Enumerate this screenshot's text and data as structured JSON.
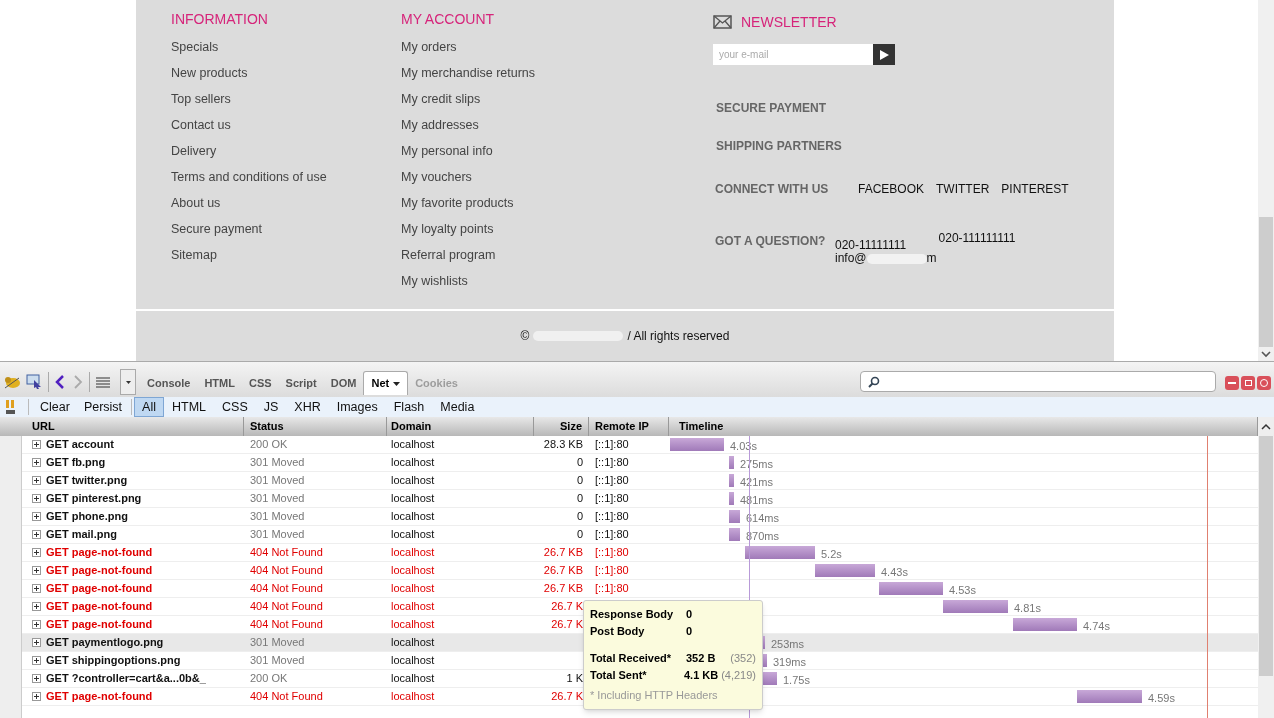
{
  "footer": {
    "columns": [
      {
        "title": "INFORMATION",
        "items": [
          "Specials",
          "New products",
          "Top sellers",
          "Contact us",
          "Delivery",
          "Terms and conditions of use",
          "About us",
          "Secure payment",
          "Sitemap"
        ]
      },
      {
        "title": "MY ACCOUNT",
        "items": [
          "My orders",
          "My merchandise returns",
          "My credit slips",
          "My addresses",
          "My personal info",
          "My vouchers",
          "My favorite products",
          "My loyalty points",
          "Referral program",
          "My wishlists"
        ]
      }
    ],
    "newsletter": {
      "title": "NEWSLETTER",
      "placeholder": "your e-mail"
    },
    "secure_payment": "SECURE PAYMENT",
    "shipping_partners": "SHIPPING PARTNERS",
    "connect": {
      "label": "CONNECT WITH US",
      "links": [
        "FACEBOOK",
        "TWITTER",
        "PINTEREST"
      ]
    },
    "question": {
      "label": "GOT A QUESTION?",
      "phone_1": "020-11111111",
      "phone_2": "020-111111111",
      "email_prefix": "info@",
      "email_suffix": "m"
    },
    "copyright": {
      "symbol": "©",
      "text": "/ All rights reserved"
    }
  },
  "firebug": {
    "tabs": [
      {
        "label": "Console",
        "selected": false,
        "disabled": false
      },
      {
        "label": "HTML",
        "selected": false,
        "disabled": false
      },
      {
        "label": "CSS",
        "selected": false,
        "disabled": false
      },
      {
        "label": "Script",
        "selected": false,
        "disabled": false
      },
      {
        "label": "DOM",
        "selected": false,
        "disabled": false
      },
      {
        "label": "Net",
        "selected": true,
        "disabled": false
      },
      {
        "label": "Cookies",
        "selected": false,
        "disabled": true
      }
    ],
    "actions": [
      "Clear",
      "Persist"
    ],
    "filters": [
      {
        "label": "All",
        "selected": true
      },
      {
        "label": "HTML",
        "selected": false
      },
      {
        "label": "CSS",
        "selected": false
      },
      {
        "label": "JS",
        "selected": false
      },
      {
        "label": "XHR",
        "selected": false
      },
      {
        "label": "Images",
        "selected": false
      },
      {
        "label": "Flash",
        "selected": false
      },
      {
        "label": "Media",
        "selected": false
      }
    ],
    "columns": [
      "URL",
      "Status",
      "Domain",
      "Size",
      "Remote IP",
      "Timeline"
    ],
    "rows": [
      {
        "url": "GET account",
        "status": "200 OK",
        "domain": "localhost",
        "size": "28.3 KB",
        "ip": "[::1]:80",
        "time": "4.03s",
        "error": false,
        "hovered": false
      },
      {
        "url": "GET fb.png",
        "status": "301 Moved",
        "domain": "localhost",
        "size": "0",
        "ip": "[::1]:80",
        "time": "275ms",
        "error": false,
        "hovered": false
      },
      {
        "url": "GET twitter.png",
        "status": "301 Moved",
        "domain": "localhost",
        "size": "0",
        "ip": "[::1]:80",
        "time": "421ms",
        "error": false,
        "hovered": false
      },
      {
        "url": "GET pinterest.png",
        "status": "301 Moved",
        "domain": "localhost",
        "size": "0",
        "ip": "[::1]:80",
        "time": "481ms",
        "error": false,
        "hovered": false
      },
      {
        "url": "GET phone.png",
        "status": "301 Moved",
        "domain": "localhost",
        "size": "0",
        "ip": "[::1]:80",
        "time": "614ms",
        "error": false,
        "hovered": false
      },
      {
        "url": "GET mail.png",
        "status": "301 Moved",
        "domain": "localhost",
        "size": "0",
        "ip": "[::1]:80",
        "time": "870ms",
        "error": false,
        "hovered": false
      },
      {
        "url": "GET page-not-found",
        "status": "404 Not Found",
        "domain": "localhost",
        "size": "26.7 KB",
        "ip": "[::1]:80",
        "time": "5.2s",
        "error": true,
        "hovered": false
      },
      {
        "url": "GET page-not-found",
        "status": "404 Not Found",
        "domain": "localhost",
        "size": "26.7 KB",
        "ip": "[::1]:80",
        "time": "4.43s",
        "error": true,
        "hovered": false
      },
      {
        "url": "GET page-not-found",
        "status": "404 Not Found",
        "domain": "localhost",
        "size": "26.7 KB",
        "ip": "[::1]:80",
        "time": "4.53s",
        "error": true,
        "hovered": false
      },
      {
        "url": "GET page-not-found",
        "status": "404 Not Found",
        "domain": "localhost",
        "size": "26.7 K",
        "time": "4.81s",
        "error": true,
        "hovered": false
      },
      {
        "url": "GET page-not-found",
        "status": "404 Not Found",
        "domain": "localhost",
        "size": "26.7 K",
        "time": "4.74s",
        "error": true,
        "hovered": false
      },
      {
        "url": "GET paymentlogo.png",
        "status": "301 Moved",
        "domain": "localhost",
        "time": "253ms",
        "error": false,
        "hovered": true
      },
      {
        "url": "GET shippingoptions.png",
        "status": "301 Moved",
        "domain": "localhost",
        "time": "319ms",
        "error": false,
        "hovered": false
      },
      {
        "url": "GET ?controller=cart&a...0b&_",
        "status": "200 OK",
        "domain": "localhost",
        "size": "1 K",
        "time": "1.75s",
        "error": false,
        "hovered": false
      },
      {
        "url": "GET page-not-found",
        "status": "404 Not Found",
        "domain": "localhost",
        "size": "26.7 K",
        "time": "4.59s",
        "error": true,
        "hovered": false
      }
    ],
    "tooltip": {
      "rows": [
        {
          "label": "Response Body",
          "value": "0"
        },
        {
          "label": "Post Body",
          "value": "0"
        },
        {
          "label": "Total Received*",
          "value": "352 B",
          "raw": "(352)"
        },
        {
          "label": "Total Sent*",
          "value": "4.1 KB",
          "raw": "(4,219)"
        }
      ],
      "note": "* Including HTTP Headers"
    }
  }
}
